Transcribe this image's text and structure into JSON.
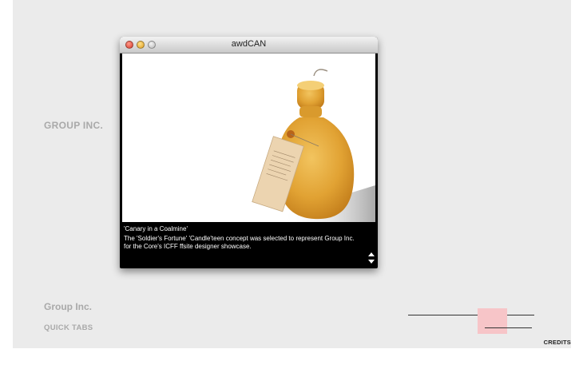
{
  "brand": {
    "name": "GROUP INC."
  },
  "window": {
    "title": "awdCAN",
    "caption_title": "'Canary in a Coalmine'",
    "caption_text": "The 'Soldier's Fortune' 'Candle'teen concept was selected to represent Group Inc. for the Core's ICFF ffsite designer showcase.",
    "image_subject": "beeswax bottle candle with paper tag"
  },
  "footer": {
    "title": "Group Inc.",
    "quick_tabs": "QUICK TABS",
    "credits": "CREDITS"
  },
  "colors": {
    "stage_bg": "#ebebeb",
    "muted_text": "#a9a9a9",
    "highlight": "#f7c5c8",
    "candle": "#e1a233"
  }
}
